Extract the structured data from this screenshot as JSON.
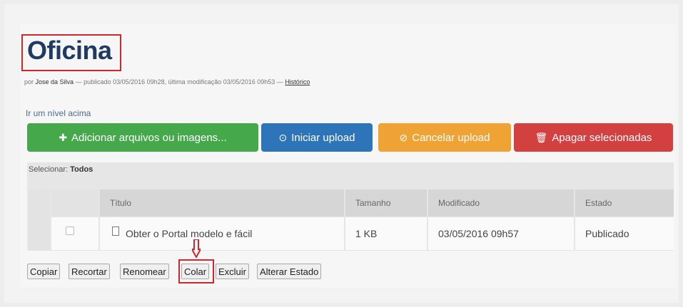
{
  "page": {
    "title": "Oficina",
    "byline_prefix": "por",
    "author": "Jose da Silva",
    "byline_middle": "— publicado 03/05/2016 09h28, última modificação 03/05/2016 09h53 —",
    "history_link": "Histórico",
    "up_link": "Ir um nível acima"
  },
  "buttons": {
    "add": "Adicionar arquivos ou imagens...",
    "upload": "Iniciar upload",
    "cancel": "Cancelar upload",
    "delete": "Apagar selecionadas"
  },
  "table": {
    "select_label": "Selecionar:",
    "select_all": "Todos",
    "headers": [
      "Título",
      "Tamanho",
      "Modificado",
      "Estado"
    ],
    "rows": [
      [
        "Obter o Portal modelo e fácil",
        "1 KB",
        "03/05/2016 09h57",
        "Publicado"
      ]
    ]
  },
  "actions": [
    "Copiar",
    "Recortar",
    "Renomear",
    "Colar",
    "Excluir",
    "Alterar Estado"
  ],
  "colors": {
    "highlight": "#d0262e",
    "add": "#45a84a",
    "upload": "#2e74b8",
    "cancel": "#efa335",
    "delete": "#d2403f",
    "title": "#1f3b62"
  },
  "icons": {
    "add": "plus-icon",
    "upload": "circle-arrow-icon",
    "cancel": "ban-icon",
    "delete": "trash-icon",
    "file": "document-icon",
    "annotation": "down-arrow-icon"
  }
}
